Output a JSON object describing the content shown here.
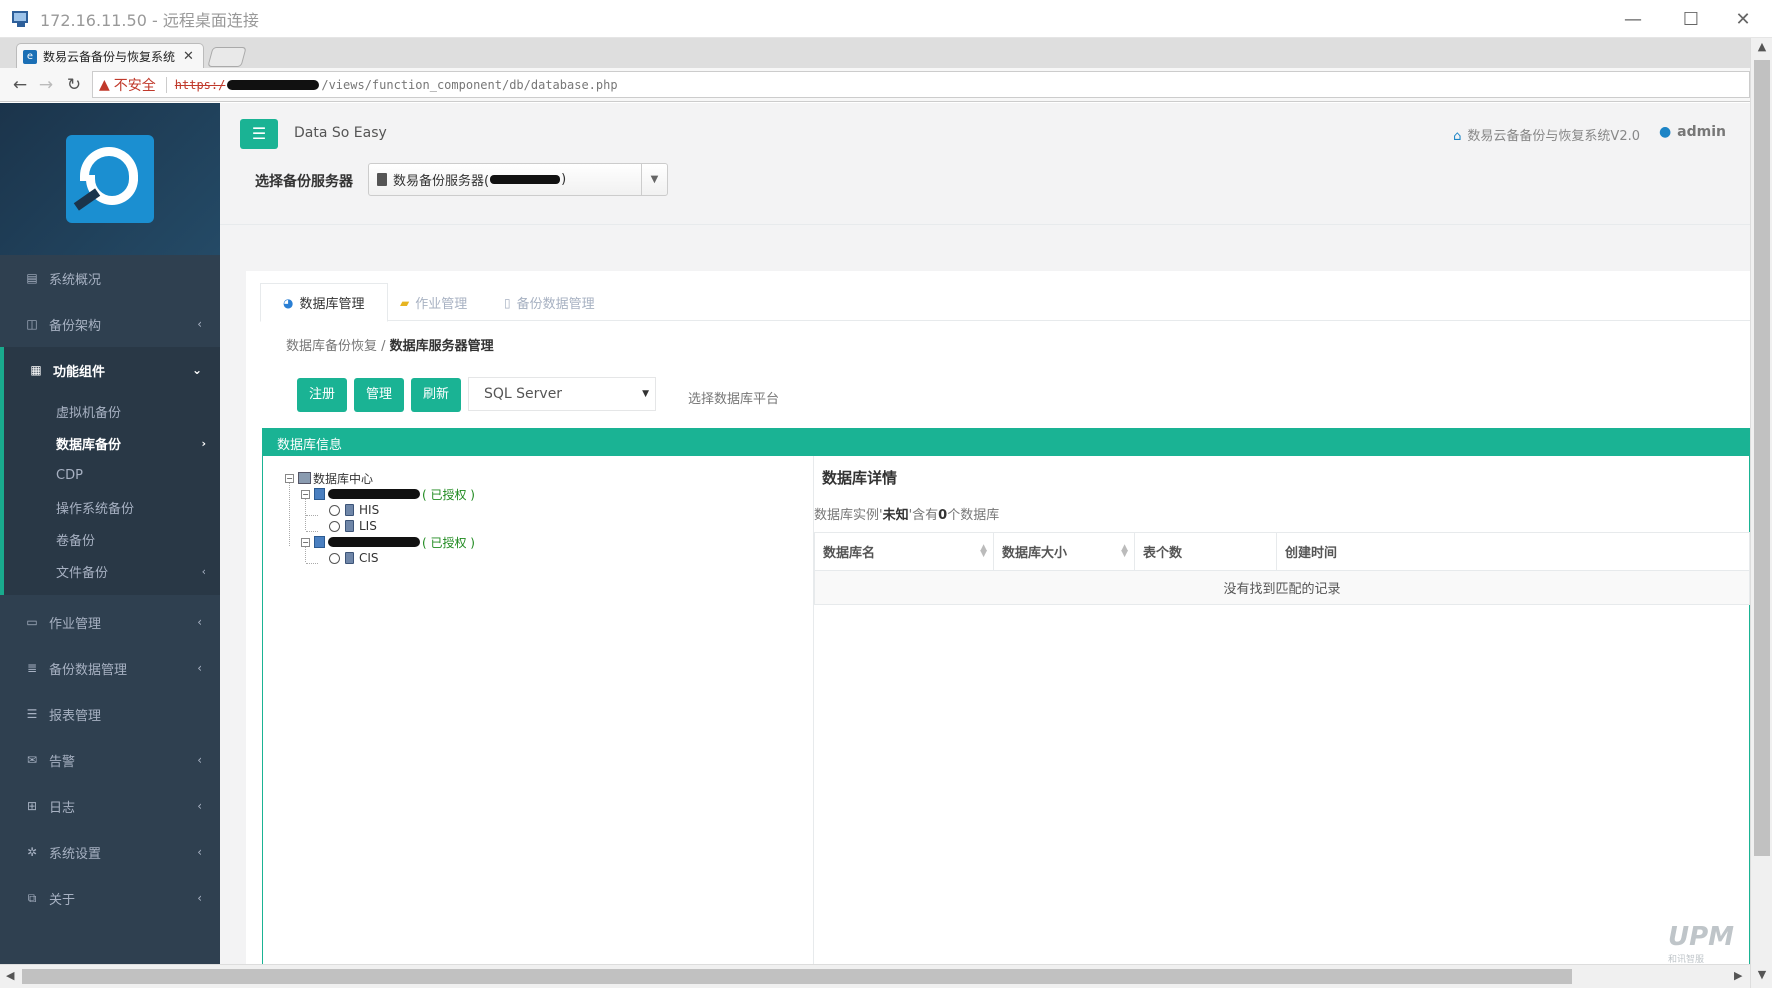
{
  "window": {
    "title": "172.16.11.50 - 远程桌面连接"
  },
  "browser": {
    "tab_title": "数易云备备份与恢复系统",
    "address": {
      "insecure_label": "不安全",
      "protocol": "https:/",
      "path": "/views/function_component/db/database.php"
    }
  },
  "header": {
    "brand": "Data So Easy",
    "system_title": "数易云备备份与恢复系统V2.0",
    "user": "admin"
  },
  "server_select": {
    "label": "选择备份服务器",
    "value_prefix": "数易备份服务器(",
    "value_suffix": ")"
  },
  "sidebar": {
    "items": [
      {
        "label": "系统概况",
        "icon": "dashboard-icon",
        "has_chevron": false
      },
      {
        "label": "备份架构",
        "icon": "columns-icon",
        "has_chevron": true
      },
      {
        "label": "功能组件",
        "icon": "bar-chart-icon",
        "active": true,
        "expanded": true
      },
      {
        "label": "作业管理",
        "icon": "desktop-icon",
        "has_chevron": true
      },
      {
        "label": "备份数据管理",
        "icon": "database-icon",
        "has_chevron": true
      },
      {
        "label": "报表管理",
        "icon": "list-icon",
        "has_chevron": false
      },
      {
        "label": "告警",
        "icon": "envelope-icon",
        "has_chevron": true
      },
      {
        "label": "日志",
        "icon": "table-icon",
        "has_chevron": true
      },
      {
        "label": "系统设置",
        "icon": "gear-icon",
        "has_chevron": true
      },
      {
        "label": "关于",
        "icon": "copy-icon",
        "has_chevron": true
      }
    ],
    "subitems": [
      {
        "label": "虚拟机备份"
      },
      {
        "label": "数据库备份",
        "active": true
      },
      {
        "label": "CDP"
      },
      {
        "label": "操作系统备份"
      },
      {
        "label": "卷备份"
      },
      {
        "label": "文件备份",
        "has_chevron": true
      }
    ]
  },
  "tabs": [
    {
      "label": "数据库管理",
      "active": true
    },
    {
      "label": "作业管理"
    },
    {
      "label": "备份数据管理"
    }
  ],
  "breadcrumb": {
    "parent": "数据库备份恢复 /",
    "current": "数据库服务器管理"
  },
  "toolbar": {
    "register_label": "注册",
    "manage_label": "管理",
    "refresh_label": "刷新",
    "platform_value": "SQL Server",
    "platform_hint": "选择数据库平台"
  },
  "db_info": {
    "title": "数据库信息",
    "tree": {
      "root": "数据库中心",
      "servers": [
        {
          "status": "( 已授权 )",
          "instances": [
            "HIS",
            "LIS"
          ]
        },
        {
          "status": "( 已授权 )",
          "instances": [
            "CIS"
          ]
        }
      ]
    }
  },
  "detail": {
    "title": "数据库详情",
    "summary_prefix": "数据库实例'",
    "summary_instance": "未知",
    "summary_mid": "'含有",
    "summary_count": "0",
    "summary_suffix": "个数据库",
    "columns": [
      "数据库名",
      "数据库大小",
      "表个数",
      "创建时间"
    ],
    "empty_text": "没有找到匹配的记录"
  },
  "watermark": {
    "logo": "UPM",
    "sub": "和讯智服"
  },
  "colors": {
    "accent": "#1ab394",
    "sidebar": "#2f4050",
    "link": "#1c84c6"
  }
}
